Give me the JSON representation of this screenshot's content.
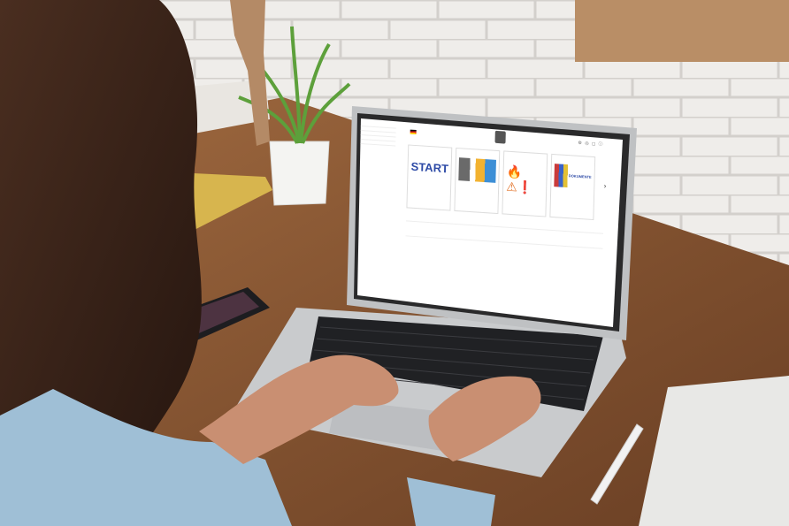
{
  "colors": {
    "wall": "#eceae7",
    "desk": "#8a5a36",
    "laptop": "#c6c8ca",
    "bezel": "#2a2a2b",
    "screen": "#ffffff",
    "shirt": "#9fbfd6",
    "hair": "#3a241a",
    "skin": "#c98f72"
  },
  "laptop_ui": {
    "sidebar_items": [
      "",
      "",
      "",
      "",
      ""
    ],
    "header_heading": "",
    "logo_caption": "",
    "cards": [
      {
        "tag": "",
        "image_text": "START",
        "title": "",
        "desc": ""
      },
      {
        "tag": "",
        "image_text": "",
        "title": "",
        "desc": ""
      },
      {
        "tag": "",
        "image_text": "",
        "title": "",
        "desc": ""
      },
      {
        "tag": "",
        "image_text": "DOKUMENTE",
        "title": "",
        "desc": ""
      }
    ],
    "section_1": "",
    "section_1_sub": "",
    "section_2": "",
    "section_2_sub": ""
  }
}
